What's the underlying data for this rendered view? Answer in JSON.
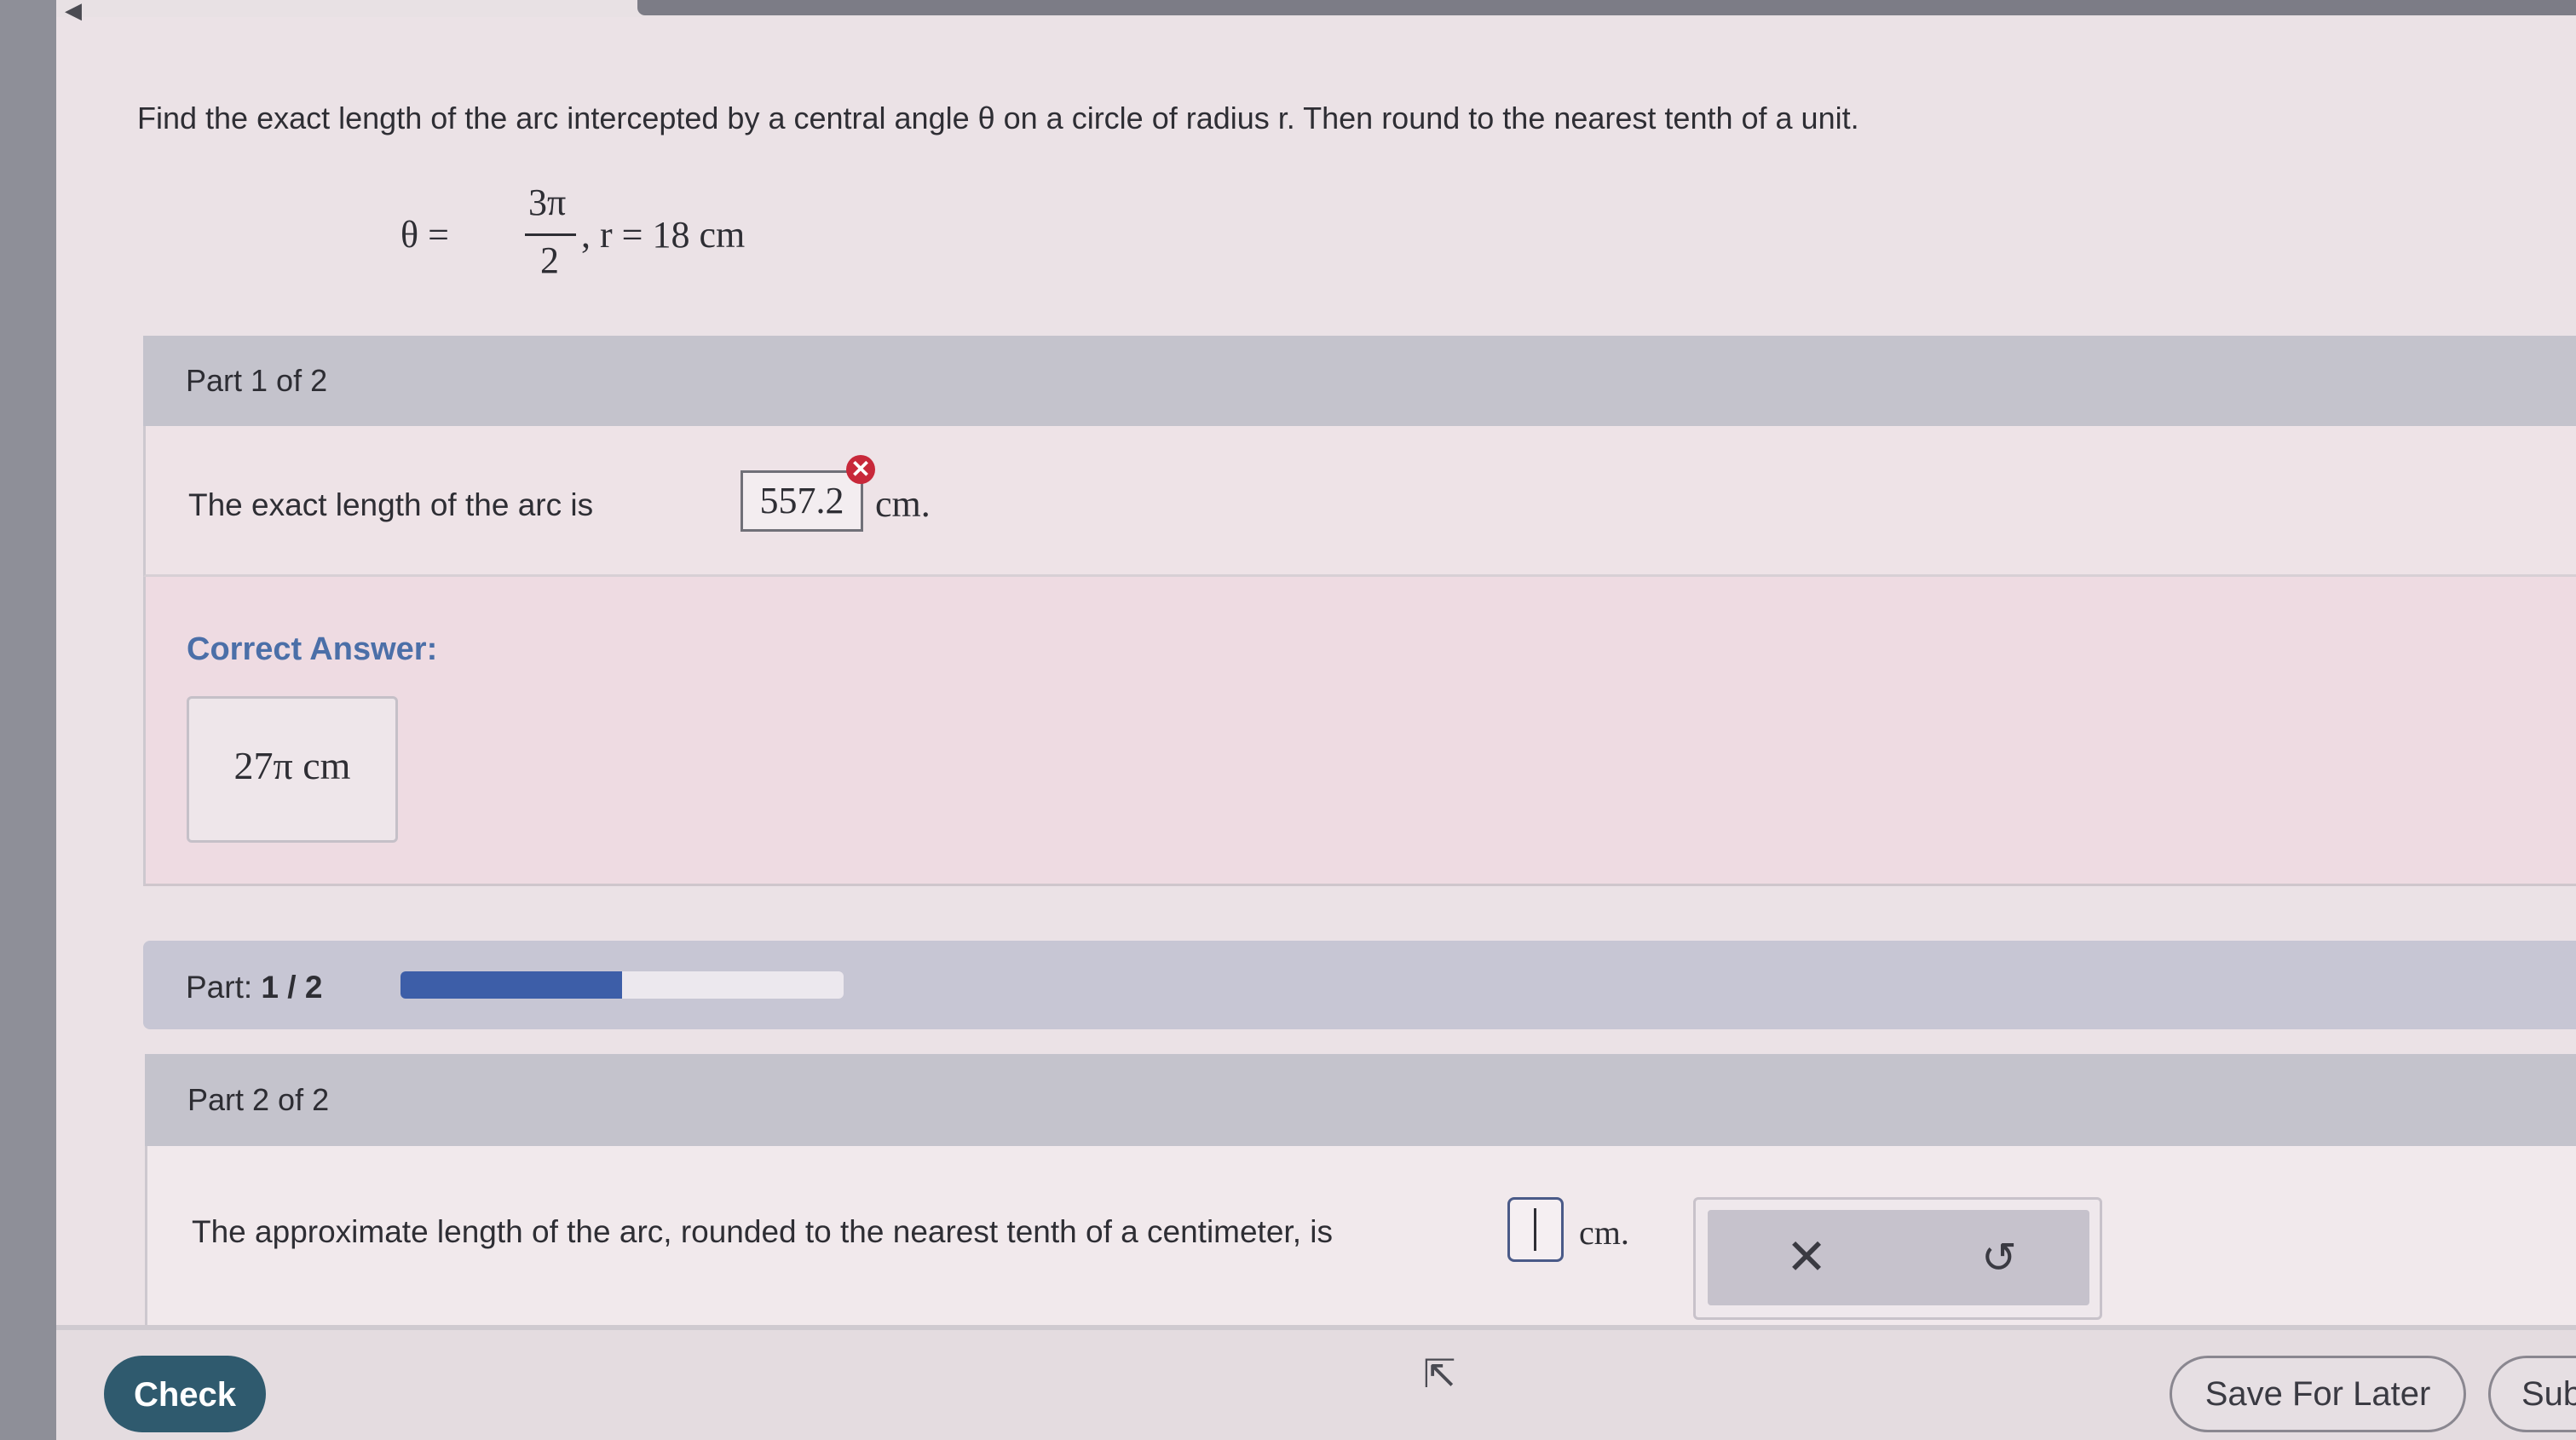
{
  "question": {
    "text": "Find the exact length of the arc intercepted by a central angle θ on a circle of radius r. Then round to the nearest tenth of a unit.",
    "formula": {
      "lhs": "θ =",
      "numerator": "3π",
      "denominator": "2",
      "rest": ",  r = 18 cm"
    }
  },
  "part1": {
    "header": "Part 1 of 2",
    "sentence": "The exact length of the arc is",
    "answer_value": "557.2",
    "unit": "cm.",
    "wrong_icon": "✕"
  },
  "correct_answer": {
    "label": "Correct Answer:",
    "value": "27π cm"
  },
  "progress": {
    "label_prefix": "Part:",
    "label_value": "1 / 2",
    "fraction": 0.5,
    "fill_color": "#3d5ea8"
  },
  "part2": {
    "header": "Part 2 of 2",
    "sentence": "The approximate length of the arc, rounded to the nearest tenth of a centimeter, is",
    "unit": "cm.",
    "clear_icon": "✕",
    "undo_icon": "↺"
  },
  "side_close_icon": "✕",
  "footer": {
    "check_label": "Check",
    "save_label": "Save For Later",
    "submit_label": "Sub"
  },
  "colors": {
    "check_button": "#2f5a6e",
    "wrong": "#c8283a",
    "correct_label": "#4b6fa8"
  }
}
